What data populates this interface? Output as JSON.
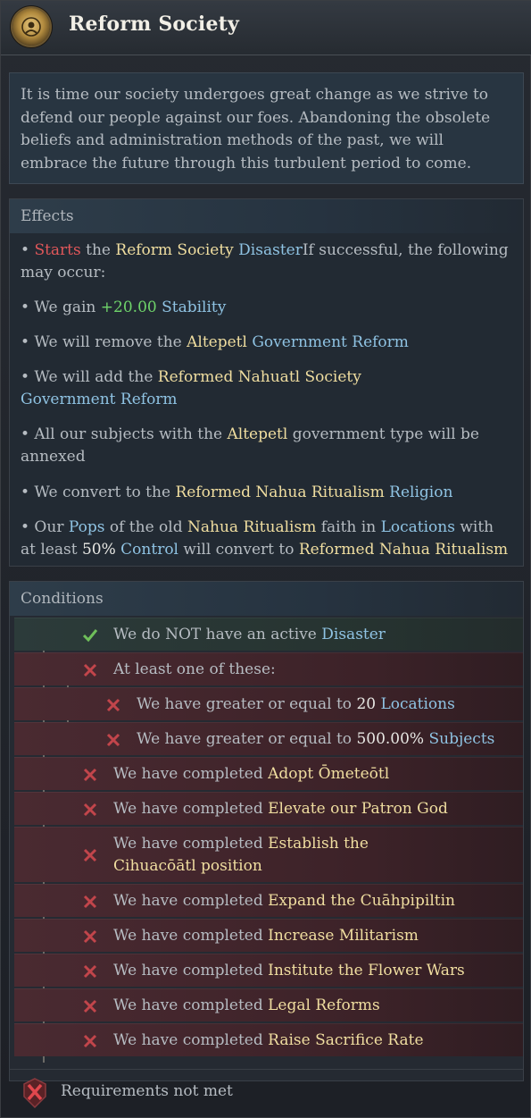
{
  "window": {
    "title": "Reform Society",
    "emblem_icon": "gold-emblem-icon"
  },
  "description": "It is time our society undergoes great change as we strive to defend our people against our foes. Abandoning the obsolete beliefs and administration methods of the past, we will embrace the future through this turbulent period to come.",
  "effects": {
    "header": "Effects",
    "e1": {
      "bullet": "• ",
      "a": "Starts",
      "b": " the ",
      "c": "Reform Society",
      "d": " ",
      "e": "Disaster",
      "f": "If successful, the following may occur:"
    },
    "e2": {
      "a": "• We gain ",
      "b": "+20.00",
      "c": " ",
      "d": "Stability"
    },
    "e3": {
      "a": "• We will remove the ",
      "b": "Altepetl",
      "c": " ",
      "d": "Government Reform"
    },
    "e4": {
      "a": "• We will add the ",
      "b": "Reformed Nahuatl Society",
      "c": " ",
      "d": "Government Reform"
    },
    "e5": {
      "a": "• All our subjects with the ",
      "b": "Altepetl",
      "c": " government type will be annexed"
    },
    "e6": {
      "a": "• We convert to the ",
      "b": "Reformed Nahua Ritualism",
      "c": " ",
      "d": "Religion"
    },
    "e7": {
      "a": "• Our ",
      "b": "Pops",
      "c": " of the old ",
      "d": "Nahua Ritualism",
      "e": " faith in ",
      "f": "Locations",
      "g": " with at least ",
      "h": "50%",
      "i": " ",
      "j": "Control",
      "k": " will convert to ",
      "l": "Reformed Nahua Ritualism"
    }
  },
  "conditions": {
    "header": "Conditions",
    "c1": {
      "a": "We do NOT have an active ",
      "b": "Disaster",
      "status": "met"
    },
    "c2": {
      "a": "At least one of these:",
      "status": "not-met"
    },
    "c3": {
      "a": "We have greater or equal to ",
      "b": "20",
      "c": " ",
      "d": "Locations",
      "status": "not-met"
    },
    "c4": {
      "a": "We have greater or equal to ",
      "b": "500.00%",
      "c": " ",
      "d": "Subjects",
      "status": "not-met"
    },
    "c5": {
      "a": "We have completed ",
      "b": "Adopt Ōmeteōtl",
      "status": "not-met"
    },
    "c6": {
      "a": "We have completed ",
      "b": "Elevate our Patron God",
      "status": "not-met"
    },
    "c7": {
      "a": "We have completed ",
      "b": "Establish the Cihuacōātl position",
      "status": "not-met"
    },
    "c8": {
      "a": "We have completed ",
      "b": "Expand the Cuāhpipiltin",
      "status": "not-met"
    },
    "c9": {
      "a": "We have completed ",
      "b": "Increase Militarism",
      "status": "not-met"
    },
    "c10": {
      "a": "We have completed ",
      "b": "Institute the Flower Wars",
      "status": "not-met"
    },
    "c11": {
      "a": "We have completed ",
      "b": "Legal Reforms",
      "status": "not-met"
    },
    "c12": {
      "a": "We have completed ",
      "b": "Raise Sacrifice Rate",
      "status": "not-met"
    }
  },
  "footer": {
    "text": "Requirements not met",
    "icon": "requirements-not-met-icon"
  },
  "colors": {
    "gold": "#f0dea0",
    "blue": "#8fc3e3",
    "red": "#e0575a",
    "green": "#6fd46a",
    "bad_row": "#4a2a31"
  }
}
